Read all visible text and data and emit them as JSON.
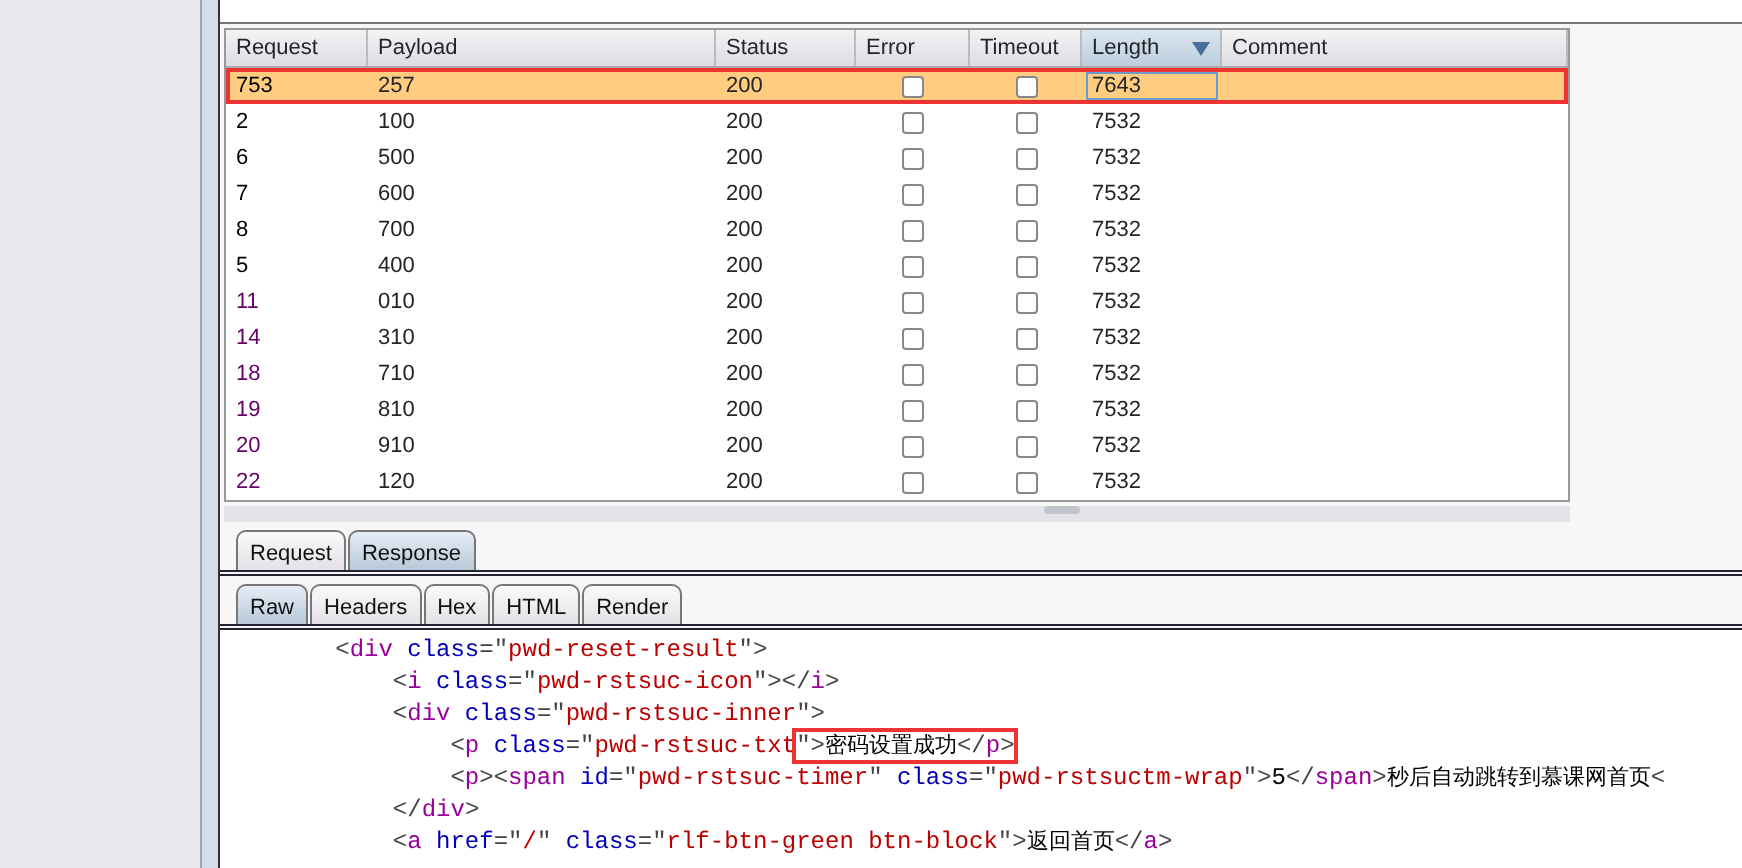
{
  "results_table": {
    "columns": [
      {
        "label": "Request",
        "sorted": false
      },
      {
        "label": "Payload",
        "sorted": false
      },
      {
        "label": "Status",
        "sorted": false
      },
      {
        "label": "Error",
        "sorted": false
      },
      {
        "label": "Timeout",
        "sorted": false
      },
      {
        "label": "Length",
        "sorted": true
      },
      {
        "label": "Comment",
        "sorted": false
      }
    ],
    "rows": [
      {
        "request": "753",
        "payload": "257",
        "status": "200",
        "error": false,
        "timeout": false,
        "length": "7643",
        "selected": true,
        "color": "#000000",
        "annotated": true
      },
      {
        "request": "2",
        "payload": "100",
        "status": "200",
        "error": false,
        "timeout": false,
        "length": "7532",
        "selected": false,
        "color": "#000000"
      },
      {
        "request": "6",
        "payload": "500",
        "status": "200",
        "error": false,
        "timeout": false,
        "length": "7532",
        "selected": false,
        "color": "#000000"
      },
      {
        "request": "7",
        "payload": "600",
        "status": "200",
        "error": false,
        "timeout": false,
        "length": "7532",
        "selected": false,
        "color": "#000000"
      },
      {
        "request": "8",
        "payload": "700",
        "status": "200",
        "error": false,
        "timeout": false,
        "length": "7532",
        "selected": false,
        "color": "#000000"
      },
      {
        "request": "5",
        "payload": "400",
        "status": "200",
        "error": false,
        "timeout": false,
        "length": "7532",
        "selected": false,
        "color": "#000000"
      },
      {
        "request": "11",
        "payload": "010",
        "status": "200",
        "error": false,
        "timeout": false,
        "length": "7532",
        "selected": false,
        "color": "#660066"
      },
      {
        "request": "14",
        "payload": "310",
        "status": "200",
        "error": false,
        "timeout": false,
        "length": "7532",
        "selected": false,
        "color": "#660066"
      },
      {
        "request": "18",
        "payload": "710",
        "status": "200",
        "error": false,
        "timeout": false,
        "length": "7532",
        "selected": false,
        "color": "#660066"
      },
      {
        "request": "19",
        "payload": "810",
        "status": "200",
        "error": false,
        "timeout": false,
        "length": "7532",
        "selected": false,
        "color": "#660066"
      },
      {
        "request": "20",
        "payload": "910",
        "status": "200",
        "error": false,
        "timeout": false,
        "length": "7532",
        "selected": false,
        "color": "#660066"
      },
      {
        "request": "22",
        "payload": "120",
        "status": "200",
        "error": false,
        "timeout": false,
        "length": "7532",
        "selected": false,
        "color": "#660066"
      }
    ]
  },
  "message_tabs": [
    {
      "label": "Request",
      "selected": false
    },
    {
      "label": "Response",
      "selected": true
    }
  ],
  "view_tabs": [
    {
      "label": "Raw",
      "selected": true
    },
    {
      "label": "Headers",
      "selected": false
    },
    {
      "label": "Hex",
      "selected": false
    },
    {
      "label": "HTML",
      "selected": false
    },
    {
      "label": "Render",
      "selected": false
    }
  ],
  "code_lines": [
    [
      {
        "kind": "punct",
        "text": "        <"
      },
      {
        "kind": "tag",
        "text": "div"
      },
      {
        "kind": "attr",
        "text": " class"
      },
      {
        "kind": "punct",
        "text": "=\""
      },
      {
        "kind": "value",
        "text": "pwd-reset-result"
      },
      {
        "kind": "punct",
        "text": "\">"
      }
    ],
    [
      {
        "kind": "punct",
        "text": "            <"
      },
      {
        "kind": "tag",
        "text": "i"
      },
      {
        "kind": "attr",
        "text": " class"
      },
      {
        "kind": "punct",
        "text": "=\""
      },
      {
        "kind": "value",
        "text": "pwd-rstsuc-icon"
      },
      {
        "kind": "punct",
        "text": "\"></"
      },
      {
        "kind": "tag",
        "text": "i"
      },
      {
        "kind": "punct",
        "text": ">"
      }
    ],
    [
      {
        "kind": "punct",
        "text": "            <"
      },
      {
        "kind": "tag",
        "text": "div"
      },
      {
        "kind": "attr",
        "text": " class"
      },
      {
        "kind": "punct",
        "text": "=\""
      },
      {
        "kind": "value",
        "text": "pwd-rstsuc-inner"
      },
      {
        "kind": "punct",
        "text": "\">"
      }
    ],
    [
      {
        "kind": "punct",
        "text": "                <"
      },
      {
        "kind": "tag",
        "text": "p"
      },
      {
        "kind": "attr",
        "text": " class"
      },
      {
        "kind": "punct",
        "text": "=\""
      },
      {
        "kind": "value",
        "text": "pwd-rstsuc-txt"
      },
      {
        "kind": "punct",
        "text": "\">",
        "annotated": true
      },
      {
        "kind": "text",
        "text": "密码设置成功",
        "annotated": true
      },
      {
        "kind": "punct",
        "text": "</",
        "annotated": true
      },
      {
        "kind": "tag",
        "text": "p",
        "annotated": true
      },
      {
        "kind": "punct",
        "text": ">",
        "annotated": true
      }
    ],
    [
      {
        "kind": "punct",
        "text": "                <"
      },
      {
        "kind": "tag",
        "text": "p"
      },
      {
        "kind": "punct",
        "text": "><"
      },
      {
        "kind": "tag",
        "text": "span"
      },
      {
        "kind": "attr",
        "text": " id"
      },
      {
        "kind": "punct",
        "text": "=\""
      },
      {
        "kind": "value",
        "text": "pwd-rstsuc-timer"
      },
      {
        "kind": "punct",
        "text": "\""
      },
      {
        "kind": "attr",
        "text": " class"
      },
      {
        "kind": "punct",
        "text": "=\""
      },
      {
        "kind": "value",
        "text": "pwd-rstsuctm-wrap"
      },
      {
        "kind": "punct",
        "text": "\">"
      },
      {
        "kind": "text",
        "text": "5"
      },
      {
        "kind": "punct",
        "text": "</"
      },
      {
        "kind": "tag",
        "text": "span"
      },
      {
        "kind": "punct",
        "text": ">"
      },
      {
        "kind": "text",
        "text": "秒后自动跳转到慕课网首页"
      },
      {
        "kind": "punct",
        "text": "<"
      }
    ],
    [
      {
        "kind": "punct",
        "text": "            </"
      },
      {
        "kind": "tag",
        "text": "div"
      },
      {
        "kind": "punct",
        "text": ">"
      }
    ],
    [
      {
        "kind": "punct",
        "text": "            <"
      },
      {
        "kind": "tag",
        "text": "a"
      },
      {
        "kind": "attr",
        "text": " href"
      },
      {
        "kind": "punct",
        "text": "=\""
      },
      {
        "kind": "value",
        "text": "/"
      },
      {
        "kind": "punct",
        "text": "\""
      },
      {
        "kind": "attr",
        "text": " class"
      },
      {
        "kind": "punct",
        "text": "=\""
      },
      {
        "kind": "value",
        "text": "rlf-btn-green btn-block"
      },
      {
        "kind": "punct",
        "text": "\">"
      },
      {
        "kind": "text",
        "text": "返回首页"
      },
      {
        "kind": "punct",
        "text": "</"
      },
      {
        "kind": "tag",
        "text": "a"
      },
      {
        "kind": "punct",
        "text": ">"
      }
    ]
  ]
}
